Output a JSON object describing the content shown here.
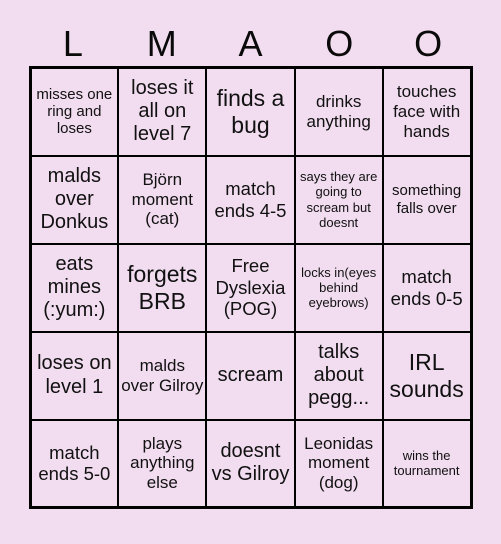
{
  "card": {
    "header_letters": [
      "L",
      "M",
      "A",
      "O",
      "O"
    ],
    "background_color": "#f2ddf0",
    "border_color": "#000000",
    "text_color": "#111111",
    "rows": [
      [
        {
          "text": "misses one ring and loses",
          "size": "fs-s"
        },
        {
          "text": "loses it all on level 7",
          "size": "fs-xl"
        },
        {
          "text": "finds a bug",
          "size": "fs-xxl"
        },
        {
          "text": "drinks anything",
          "size": "fs-m"
        },
        {
          "text": "touches face with hands",
          "size": "fs-m"
        }
      ],
      [
        {
          "text": "malds over Donkus",
          "size": "fs-xl"
        },
        {
          "text": "Björn moment (cat)",
          "size": "fs-m"
        },
        {
          "text": "match ends 4-5",
          "size": "fs-l"
        },
        {
          "text": "says they are going to scream but doesnt",
          "size": "fs-xs"
        },
        {
          "text": "something falls over",
          "size": "fs-s"
        }
      ],
      [
        {
          "text": "eats mines (:yum:)",
          "size": "fs-xl"
        },
        {
          "text": "forgets BRB",
          "size": "fs-xxl"
        },
        {
          "text": "Free Dyslexia (POG)",
          "size": "fs-l"
        },
        {
          "text": "locks in(eyes behind eyebrows)",
          "size": "fs-xs"
        },
        {
          "text": "match ends 0-5",
          "size": "fs-l"
        }
      ],
      [
        {
          "text": "loses on level 1",
          "size": "fs-xl"
        },
        {
          "text": "malds over Gilroy",
          "size": "fs-m"
        },
        {
          "text": "scream",
          "size": "fs-xl"
        },
        {
          "text": "talks about pegg...",
          "size": "fs-xl"
        },
        {
          "text": "IRL sounds",
          "size": "fs-xxl"
        }
      ],
      [
        {
          "text": "match ends 5-0",
          "size": "fs-l"
        },
        {
          "text": "plays anything else",
          "size": "fs-m"
        },
        {
          "text": "doesnt vs Gilroy",
          "size": "fs-xl"
        },
        {
          "text": "Leonidas moment (dog)",
          "size": "fs-m"
        },
        {
          "text": "wins the tournament",
          "size": "fs-xs"
        }
      ]
    ]
  }
}
